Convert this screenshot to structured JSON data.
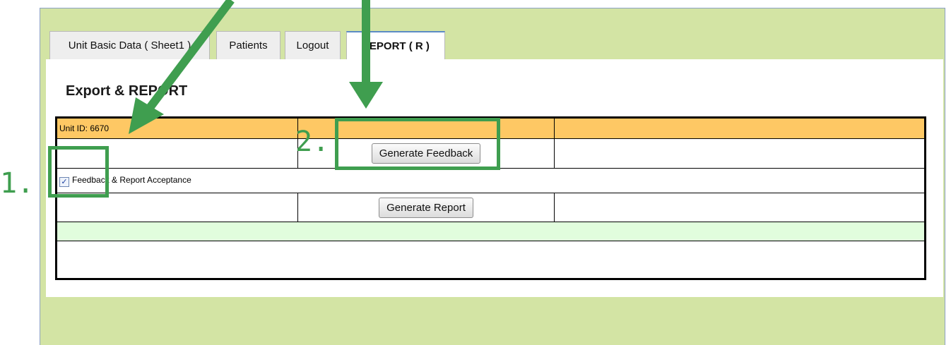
{
  "tabs": [
    {
      "label": "Unit Basic Data ( Sheet1 )"
    },
    {
      "label": "Patients"
    },
    {
      "label": "Logout"
    },
    {
      "label": "REPORT ( R )"
    }
  ],
  "page": {
    "title": "Export & REPORT"
  },
  "table": {
    "unit_id": "Unit ID: 6670",
    "feedback_button": "Generate Feedback",
    "checkbox_label": "Feedback & Report Acceptance",
    "checkbox_checked": true,
    "report_button": "Generate Report"
  },
  "annotations": {
    "step1": "1.",
    "step2": "2.",
    "color": "#3f9e4f"
  },
  "colors": {
    "background": "#d3e4a4",
    "header_row": "#fec864",
    "green_row": "#e1fddd",
    "active_tab_border": "#5b8bc5"
  }
}
